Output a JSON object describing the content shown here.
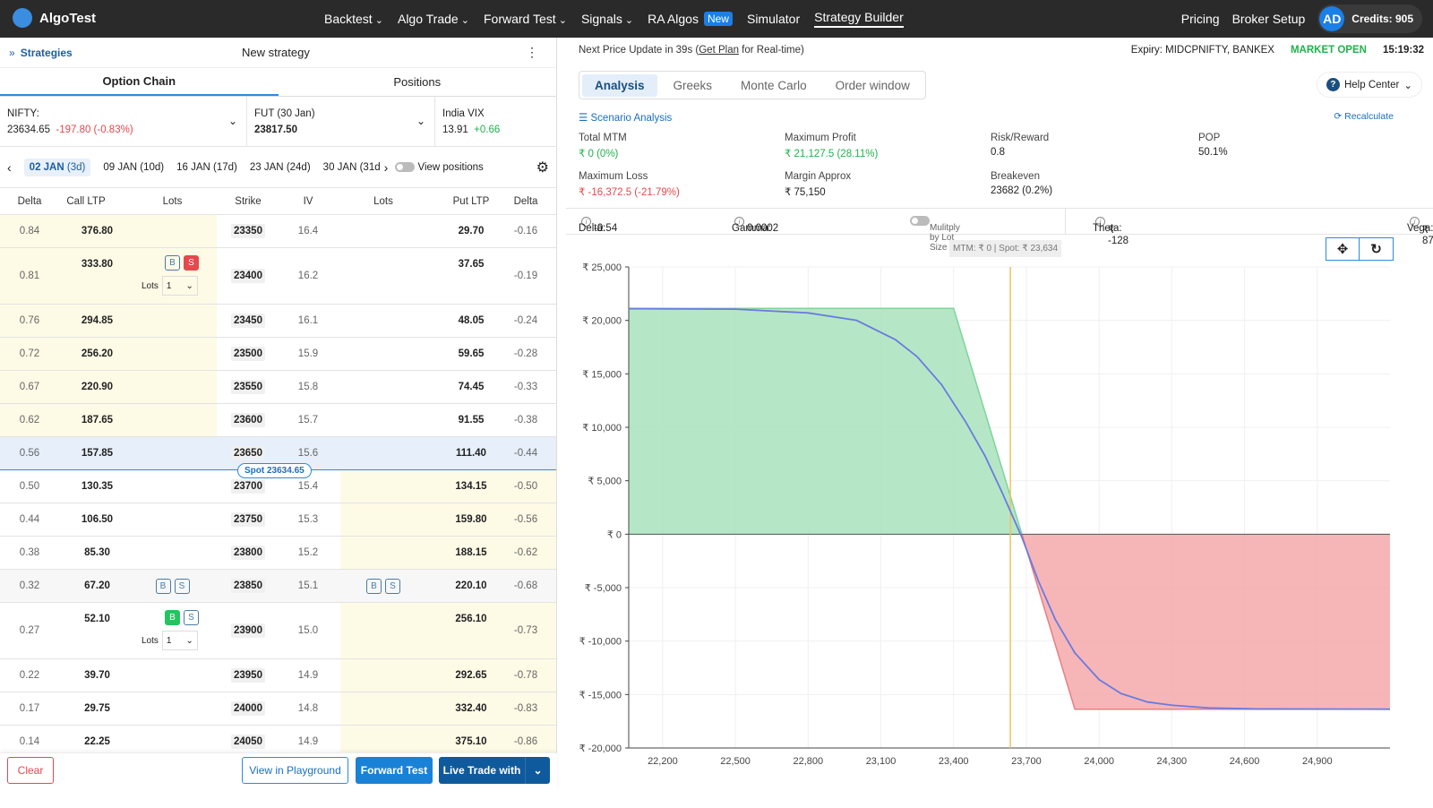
{
  "nav": {
    "brand": "AlgoTest",
    "items": [
      {
        "label": "Backtest",
        "dropdown": true
      },
      {
        "label": "Algo Trade",
        "dropdown": true
      },
      {
        "label": "Forward Test",
        "dropdown": true
      },
      {
        "label": "Signals",
        "dropdown": true
      },
      {
        "label": "RA Algos",
        "badge": "New"
      },
      {
        "label": "Simulator"
      },
      {
        "label": "Strategy Builder",
        "active": true
      }
    ],
    "pricing": "Pricing",
    "broker": "Broker Setup",
    "avatar": "AD",
    "credits": "Credits: 905"
  },
  "left": {
    "strategies": "Strategies",
    "title": "New strategy",
    "tabs": [
      "Option Chain",
      "Positions"
    ],
    "nifty": {
      "label": "NIFTY:",
      "price": "23634.65",
      "change": "-197.80 (-0.83%)"
    },
    "fut": {
      "label": "FUT (30 Jan)",
      "price": "23817.50"
    },
    "vix": {
      "label": "India VIX",
      "price": "13.91",
      "change": "+0.66"
    },
    "expiries": [
      {
        "date": "02 JAN",
        "days": "(3d)"
      },
      {
        "date": "09 JAN",
        "days": "(10d)"
      },
      {
        "date": "16 JAN",
        "days": "(17d)"
      },
      {
        "date": "23 JAN",
        "days": "(24d)"
      },
      {
        "date": "30 JAN",
        "days": "(31d"
      }
    ],
    "view_positions": "View positions",
    "headers": [
      "Delta",
      "Call LTP",
      "Lots",
      "Strike",
      "IV",
      "Lots",
      "Put LTP",
      "Delta"
    ],
    "spot_label": "Spot 23634.65",
    "lots_label": "Lots",
    "lots_value": "1",
    "rows": [
      {
        "cd": "0.84",
        "call": "376.80",
        "strike": "23350",
        "iv": "16.4",
        "put": "29.70",
        "pd": "-0.16"
      },
      {
        "cd": "0.81",
        "call": "333.80",
        "strike": "23400",
        "iv": "16.2",
        "put": "37.65",
        "pd": "-0.19",
        "call_order": "S"
      },
      {
        "cd": "0.76",
        "call": "294.85",
        "strike": "23450",
        "iv": "16.1",
        "put": "48.05",
        "pd": "-0.24"
      },
      {
        "cd": "0.72",
        "call": "256.20",
        "strike": "23500",
        "iv": "15.9",
        "put": "59.65",
        "pd": "-0.28"
      },
      {
        "cd": "0.67",
        "call": "220.90",
        "strike": "23550",
        "iv": "15.8",
        "put": "74.45",
        "pd": "-0.33"
      },
      {
        "cd": "0.62",
        "call": "187.65",
        "strike": "23600",
        "iv": "15.7",
        "put": "91.55",
        "pd": "-0.38"
      },
      {
        "cd": "0.56",
        "call": "157.85",
        "strike": "23650",
        "iv": "15.6",
        "put": "111.40",
        "pd": "-0.44",
        "atm": true
      },
      {
        "cd": "0.50",
        "call": "130.35",
        "strike": "23700",
        "iv": "15.4",
        "put": "134.15",
        "pd": "-0.50"
      },
      {
        "cd": "0.44",
        "call": "106.50",
        "strike": "23750",
        "iv": "15.3",
        "put": "159.80",
        "pd": "-0.56"
      },
      {
        "cd": "0.38",
        "call": "85.30",
        "strike": "23800",
        "iv": "15.2",
        "put": "188.15",
        "pd": "-0.62"
      },
      {
        "cd": "0.32",
        "call": "67.20",
        "strike": "23850",
        "iv": "15.1",
        "put": "220.10",
        "pd": "-0.68",
        "hover": true
      },
      {
        "cd": "0.27",
        "call": "52.10",
        "strike": "23900",
        "iv": "15.0",
        "put": "256.10",
        "pd": "-0.73",
        "call_order": "B"
      },
      {
        "cd": "0.22",
        "call": "39.70",
        "strike": "23950",
        "iv": "14.9",
        "put": "292.65",
        "pd": "-0.78"
      },
      {
        "cd": "0.17",
        "call": "29.75",
        "strike": "24000",
        "iv": "14.8",
        "put": "332.40",
        "pd": "-0.83"
      },
      {
        "cd": "0.14",
        "call": "22.25",
        "strike": "24050",
        "iv": "14.9",
        "put": "375.10",
        "pd": "-0.86"
      }
    ],
    "buttons": {
      "clear": "Clear",
      "playground": "View in Playground",
      "forward": "Forward Test",
      "live": "Live Trade with"
    }
  },
  "right": {
    "update_prefix": "Next Price Update in 39s (",
    "get_plan": "Get Plan",
    "update_suffix": " for Real-time)",
    "expiry": "Expiry:  MIDCPNIFTY, BANKEX",
    "market": "MARKET OPEN",
    "time": "15:19:32",
    "tabs": [
      "Analysis",
      "Greeks",
      "Monte Carlo",
      "Order window"
    ],
    "help": "Help Center",
    "scenario": "Scenario Analysis",
    "recalc": "Recalculate",
    "stats": [
      {
        "label": "Total MTM",
        "value": "₹ 0 (0%)",
        "color": "green"
      },
      {
        "label": "Maximum Profit",
        "value": "₹ 21,127.5 (28.11%)",
        "color": "green"
      },
      {
        "label": "Risk/Reward",
        "value": "0.8"
      },
      {
        "label": "POP",
        "value": "50.1%"
      },
      {
        "label": "Maximum Loss",
        "value": "₹ -16,372.5 (-21.79%)",
        "color": "red"
      },
      {
        "label": "Margin Approx",
        "value": "₹ 75,150"
      },
      {
        "label": "Breakeven",
        "value": "23682 (0.2%)"
      }
    ],
    "greeks": {
      "delta_l": "Delta:",
      "delta": "-0.54",
      "gamma_l": "Gamma:",
      "gamma": "0.0002",
      "multiply": "Mulitply by Lot Size",
      "theta_l": "Theta:",
      "theta": "₹ -128",
      "vega_l": "Vega:",
      "vega": "₹ 87"
    },
    "tooltip": "MTM: ₹ 0  |  Spot: ₹ 23,634"
  },
  "chart_data": {
    "type": "area",
    "xlim": [
      22060,
      25200
    ],
    "ylim": [
      -20000,
      25000
    ],
    "xticks": [
      22200,
      22500,
      22800,
      23100,
      23400,
      23700,
      24000,
      24300,
      24600,
      24900
    ],
    "yticks": [
      25000,
      20000,
      15000,
      10000,
      5000,
      0,
      -5000,
      -10000,
      -15000,
      -20000
    ],
    "xtick_labels": [
      "22,200",
      "22,500",
      "22,800",
      "23,100",
      "23,400",
      "23,700",
      "24,000",
      "24,300",
      "24,600",
      "24,900"
    ],
    "ytick_labels": [
      "₹ 25,000",
      "₹ 20,000",
      "₹ 15,000",
      "₹ 10,000",
      "₹ 5,000",
      "₹ 0",
      "₹ -5,000",
      "₹ -10,000",
      "₹ -15,000",
      "₹ -20,000"
    ],
    "expiry_payoff": {
      "x": [
        22060,
        23400,
        23900,
        25200
      ],
      "y": [
        21127.5,
        21127.5,
        -16372.5,
        -16372.5
      ]
    },
    "target_payoff": {
      "x": [
        22060,
        22500,
        22800,
        23000,
        23160,
        23250,
        23350,
        23450,
        23530,
        23600,
        23680,
        23750,
        23820,
        23900,
        24000,
        24090,
        24200,
        24300,
        24450,
        24650,
        25200
      ],
      "y": [
        21100,
        21050,
        20700,
        20000,
        18200,
        16600,
        14000,
        10500,
        7300,
        3900,
        -200,
        -4400,
        -8000,
        -11100,
        -13600,
        -14900,
        -15700,
        -16000,
        -16250,
        -16350,
        -16370
      ]
    },
    "spot": 23634,
    "profit_color": "#a8e3bd",
    "loss_color": "#f4a9ab",
    "curve_color": "#6a7be0",
    "spot_color": "#f0c060"
  }
}
